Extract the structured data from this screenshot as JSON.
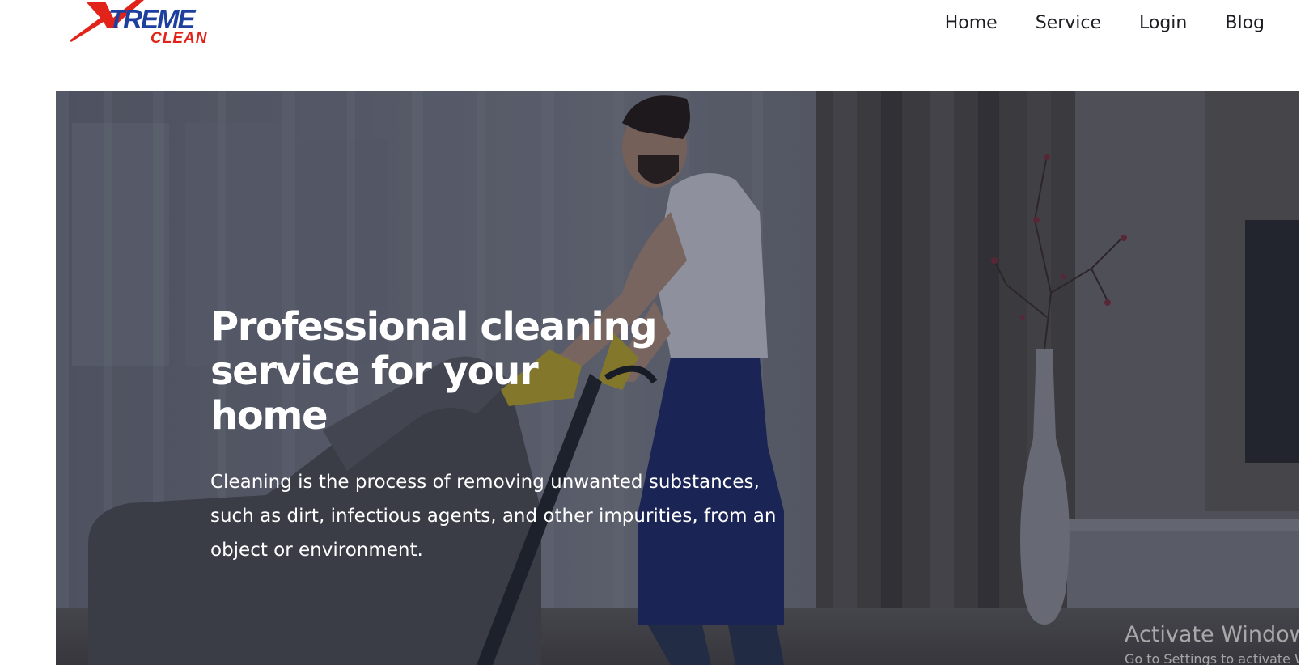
{
  "brand": {
    "logo_text_top": "XTREME",
    "logo_text_bottom": "CLEAN",
    "colors": {
      "x_red": "#e2231a",
      "word_blue": "#1d3f9e"
    }
  },
  "nav": {
    "items": [
      {
        "label": "Home"
      },
      {
        "label": "Service"
      },
      {
        "label": "Login"
      },
      {
        "label": "Blog"
      }
    ]
  },
  "hero": {
    "title": "Professional cleaning service for your home",
    "description": "Cleaning is the process of removing unwanted substances, such as dirt, infectious agents, and other impurities, from an object or environment.",
    "overlay_color": "#141a30"
  },
  "watermark": {
    "title": "Activate Windows",
    "subtitle": "Go to Settings to activate Windows."
  }
}
